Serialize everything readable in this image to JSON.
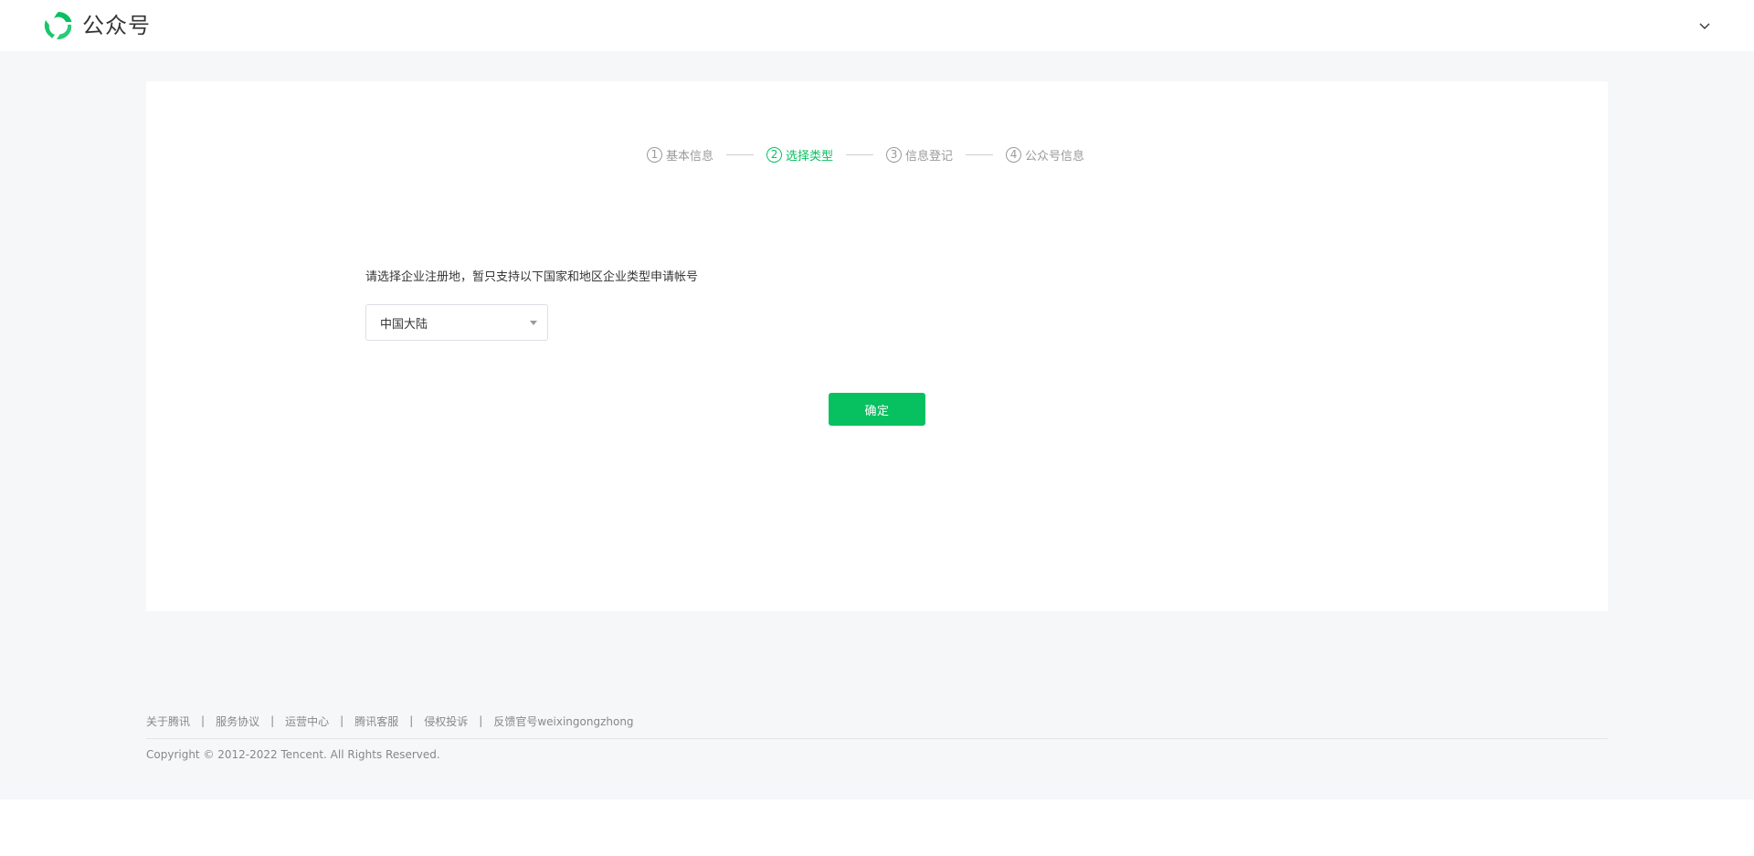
{
  "header": {
    "brand": "公众号",
    "brand_color": "#07c160",
    "logo_icon": "wechat-official-account-logo",
    "account_menu_icon": "chevron-down-icon"
  },
  "steps": [
    {
      "number": "1",
      "label": "基本信息",
      "active": false
    },
    {
      "number": "2",
      "label": "选择类型",
      "active": true
    },
    {
      "number": "3",
      "label": "信息登记",
      "active": false
    },
    {
      "number": "4",
      "label": "公众号信息",
      "active": false
    }
  ],
  "form": {
    "prompt": "请选择企业注册地，暂只支持以下国家和地区企业类型申请帐号",
    "region_select": {
      "value": "中国大陆"
    },
    "confirm_label": "确定"
  },
  "footer": {
    "links": [
      "关于腾讯",
      "服务协议",
      "运营中心",
      "腾讯客服",
      "侵权投诉",
      "反馈官号weixingongzhong"
    ],
    "separator": "|",
    "copyright": "Copyright © 2012-2022 Tencent. All Rights Reserved."
  }
}
